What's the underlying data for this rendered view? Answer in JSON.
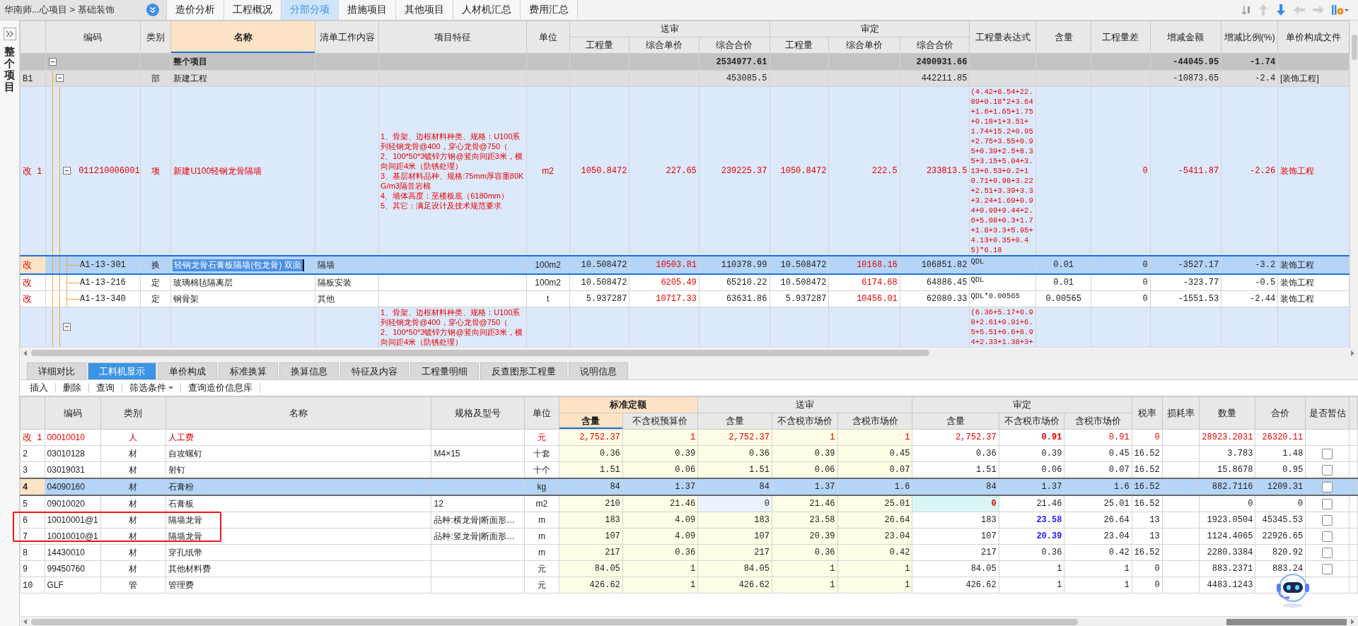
{
  "breadcrumb": "华南师...心项目 > 基础装饰",
  "tabs": [
    {
      "label": "造价分析",
      "selected": false
    },
    {
      "label": "工程概况",
      "selected": false
    },
    {
      "label": "分部分项",
      "selected": true
    },
    {
      "label": "措施项目",
      "selected": false
    },
    {
      "label": "其他项目",
      "selected": false
    },
    {
      "label": "人材机汇总",
      "selected": false
    },
    {
      "label": "费用汇总",
      "selected": false
    }
  ],
  "side_panel": {
    "title": "整个项目"
  },
  "upper_grid": {
    "header": [
      {
        "label": "编码",
        "selected": false
      },
      {
        "label": "类别",
        "selected": false
      },
      {
        "label": "名称",
        "selected": true
      },
      {
        "label": "清单工作内容",
        "selected": false
      },
      {
        "label": "项目特征",
        "selected": false
      },
      {
        "label": "单位",
        "selected": false
      },
      {
        "group": "送审",
        "columns": [
          {
            "label": "工程量",
            "selected": false
          },
          {
            "label": "综合单价",
            "selected": false
          },
          {
            "label": "综合合价",
            "selected": false
          }
        ]
      },
      {
        "group": "审定",
        "columns": [
          {
            "label": "工程量",
            "selected": false
          },
          {
            "label": "综合单价",
            "selected": false
          },
          {
            "label": "综合合价",
            "selected": false
          }
        ]
      },
      {
        "label": "工程量表达式",
        "selected": false
      },
      {
        "label": "含量",
        "selected": false
      },
      {
        "label": "工程量差",
        "selected": false
      },
      {
        "label": "增减金额",
        "selected": false
      },
      {
        "label": "增减比例(%)",
        "selected": false
      },
      {
        "label": "单价构成文件",
        "selected": false
      }
    ],
    "rows": [
      {
        "kind": "total",
        "expanded": true,
        "selected": false,
        "cells": [
          null,
          "整个项目",
          null,
          null,
          null,
          null,
          null,
          "2534977.61",
          null,
          null,
          "2490931.66",
          null,
          null,
          null,
          "-44045.95",
          "-1.74",
          null
        ],
        "children": [
          {
            "kind": "section",
            "number": "B1",
            "expanded": true,
            "selected": false,
            "cells": [
              "部",
              "新建工程",
              null,
              null,
              null,
              null,
              null,
              "453085.5",
              null,
              null,
              "442211.85",
              null,
              null,
              null,
              "-10873.65",
              "-2.4",
              "[装饰工程]"
            ],
            "children": [
              {
                "kind": "item",
                "flag": "改",
                "number": "1",
                "code": "011210006001",
                "expanded": true,
                "selected": false,
                "cells": [
                  "项",
                  "新建U100轻钢龙骨隔墙",
                  null,
                  "1、骨架、边框材料种类、规格：U100系列轻钢龙骨@400，穿心龙骨@750（\n2、100*50*3镀锌方钢@竖向间距3米，横向间距4米（防锈处理）\n3、基层材料品种、规格:75mm厚容重80KG/m3隔音岩棉\n4、墙体高度：至楼板底（6180mm）\n5、其它：满足设计及技术规范要求",
                  "m2",
                  "1050.8472",
                  "227.65",
                  "239225.37",
                  "1050.8472",
                  "222.5",
                  "233813.5",
                  "(4.42+8.54+22.89+0.18*2+3.64+1.6+1.65+1.75+0.18+1+3.51+1.74+15.2+0.95+2.75+3.55+0.95+0.39+2.5+8.35+3.15+5.04+3.13+6.53+0.2+10.71+0.98+3.22+2.51+3.39+3.3+3.24+1.69+0.94+0.99+9.44+2.6+5.08+0.3+1.7+1.8+3.3+5.95+4.13+0.35+0.45)*6.18",
                  null,
                  "0",
                  "-5411.87",
                  "-2.26",
                  "装饰工程"
                ],
                "children": [
                  {
                    "kind": "quota",
                    "flag": "改",
                    "code": "A1-13-301",
                    "selected": true,
                    "cells": [
                      "换",
                      {
                        "text": "轻钢龙骨石膏板隔墙(包龙骨) 双面",
                        "kind": "editing"
                      },
                      "隔墙",
                      null,
                      "100m2",
                      "10.508472",
                      {
                        "text": "10503.81",
                        "kind": "changed"
                      },
                      "110378.99",
                      "10.508472",
                      {
                        "text": "10168.16",
                        "kind": "changed"
                      },
                      "106851.82",
                      "QDL",
                      "0.01",
                      "0",
                      "-3527.17",
                      "-3.2",
                      "装饰工程"
                    ]
                  },
                  {
                    "kind": "quota",
                    "flag": "改",
                    "code": "A1-13-216",
                    "selected": false,
                    "cells": [
                      "定",
                      "玻璃棉毡隔离层",
                      "隔板安装",
                      null,
                      "100m2",
                      "10.508472",
                      {
                        "text": "6205.49",
                        "kind": "changed"
                      },
                      "65210.22",
                      "10.508472",
                      {
                        "text": "6174.68",
                        "kind": "changed"
                      },
                      "64886.45",
                      "QDL",
                      "0.01",
                      "0",
                      "-323.77",
                      "-0.5",
                      "装饰工程"
                    ]
                  },
                  {
                    "kind": "quota",
                    "flag": "改",
                    "code": "A1-13-340",
                    "selected": false,
                    "cells": [
                      "定",
                      "钢骨架",
                      "其他",
                      null,
                      "t",
                      "5.937287",
                      {
                        "text": "10717.33",
                        "kind": "changed"
                      },
                      "63631.86",
                      "5.937287",
                      {
                        "text": "10456.01",
                        "kind": "changed"
                      },
                      "62080.33",
                      "QDL*0.00565",
                      "0.00565",
                      "0",
                      "-1551.53",
                      "-2.44",
                      "装饰工程"
                    ]
                  }
                ]
              },
              {
                "kind": "item",
                "expanded": true,
                "selected": false,
                "cells": [
                  null,
                  null,
                  null,
                  "1、骨架、边框材料种类、规格：U100系列轻钢龙骨@400，穿心龙骨@750（\n2、100*50*3镀锌方钢@竖向间距3米，横向间距4米（防锈处理）",
                  null,
                  null,
                  null,
                  null,
                  null,
                  null,
                  null,
                  "(6.36+5.17+0.98+2.61+0.91+6.5+5.51+0.6+8.94+2.33+1.38+3+",
                  null,
                  null,
                  null,
                  null,
                  null
                ]
              }
            ]
          }
        ]
      }
    ]
  },
  "detail_tabs": [
    {
      "label": "详细对比",
      "selected": false
    },
    {
      "label": "工料机显示",
      "selected": true
    },
    {
      "label": "单价构成",
      "selected": false
    },
    {
      "label": "标准换算",
      "selected": false
    },
    {
      "label": "换算信息",
      "selected": false
    },
    {
      "label": "特征及内容",
      "selected": false
    },
    {
      "label": "工程量明细",
      "selected": false
    },
    {
      "label": "反查图形工程量",
      "selected": false
    },
    {
      "label": "说明信息",
      "selected": false
    }
  ],
  "toolbar": [
    {
      "label": "插入",
      "dropdown": false
    },
    {
      "label": "删除",
      "dropdown": false
    },
    {
      "label": "查询",
      "dropdown": false
    },
    {
      "label": "筛选条件",
      "dropdown": true
    },
    {
      "label": "查询造价信息库",
      "dropdown": false
    }
  ],
  "lower_grid": {
    "header": [
      {
        "label": "编码",
        "selected": false
      },
      {
        "label": "类别",
        "selected": false
      },
      {
        "label": "名称",
        "selected": false
      },
      {
        "label": "规格及型号",
        "selected": false
      },
      {
        "label": "单位",
        "selected": false
      },
      {
        "group": "标准定额",
        "columns": [
          {
            "label": "含量",
            "selected": true
          },
          {
            "label": "不含税预算价",
            "selected": false
          }
        ]
      },
      {
        "group": "送审",
        "columns": [
          {
            "label": "含量",
            "selected": false
          },
          {
            "label": "不含税市场价",
            "selected": false
          },
          {
            "label": "含税市场价",
            "selected": false
          }
        ]
      },
      {
        "group": "审定",
        "columns": [
          {
            "label": "含量",
            "selected": false
          },
          {
            "label": "不含税市场价",
            "selected": false
          },
          {
            "label": "含税市场价",
            "selected": false
          }
        ]
      },
      {
        "label": "税率",
        "selected": false
      },
      {
        "label": "损耗率",
        "selected": false
      },
      {
        "label": "数量",
        "selected": false
      },
      {
        "label": "合价",
        "selected": false
      },
      {
        "label": "是否暂估",
        "selected": false
      }
    ],
    "rows": [
      {
        "flag": "改",
        "number": "1",
        "modified": true,
        "selected": false,
        "cells": [
          "00010010",
          "人",
          "人工费",
          null,
          "元",
          "2,752.37",
          "1",
          "2,752.37",
          "1",
          "1",
          "2,752.37",
          {
            "text": "0.91",
            "kind": "adjusted"
          },
          "0.91",
          "0",
          null,
          "28923.2031",
          "26320.11"
        ]
      },
      {
        "number": "2",
        "modified": false,
        "selected": false,
        "provisional": false,
        "cells": [
          "03010128",
          "材",
          "自攻螺钉",
          "M4×15",
          "十套",
          "0.36",
          "0.39",
          "0.36",
          "0.39",
          "0.45",
          "0.36",
          "0.39",
          "0.45",
          "16.52",
          null,
          "3.783",
          "1.48"
        ]
      },
      {
        "number": "3",
        "modified": false,
        "selected": false,
        "provisional": false,
        "cells": [
          "03019031",
          "材",
          "射钉",
          null,
          "十个",
          "1.51",
          "0.06",
          "1.51",
          "0.06",
          "0.07",
          "1.51",
          "0.06",
          "0.07",
          "16.52",
          null,
          "15.8678",
          "0.95"
        ]
      },
      {
        "number": "4",
        "modified": false,
        "selected": true,
        "provisional": false,
        "cells": [
          "04090160",
          "材",
          "石膏粉",
          null,
          "kg",
          "84",
          "1.37",
          "84",
          "1.37",
          "1.6",
          "84",
          "1.37",
          "1.6",
          "16.52",
          null,
          "882.7116",
          "1209.31"
        ]
      },
      {
        "number": "5",
        "modified": false,
        "selected": false,
        "provisional": false,
        "cells": [
          "09010020",
          "材",
          "石膏板",
          "12",
          "m2",
          "210",
          "21.46",
          {
            "text": "0",
            "kind": "pale"
          },
          "21.46",
          "25.01",
          {
            "text": "0",
            "kind": "zeroed"
          },
          "21.46",
          "25.01",
          "16.52",
          null,
          "0",
          "0"
        ]
      },
      {
        "number": "6",
        "modified": false,
        "selected": false,
        "provisional": false,
        "cells": [
          "10010001@1",
          "材",
          "隔墙龙骨",
          "品种:横龙骨|断面形…",
          "m",
          "183",
          "4.09",
          "183",
          "23.58",
          "26.64",
          "183",
          {
            "text": "23.58",
            "kind": "raised"
          },
          "26.64",
          "13",
          null,
          "1923.0504",
          "45345.53"
        ]
      },
      {
        "number": "7",
        "modified": false,
        "selected": false,
        "provisional": false,
        "cells": [
          "10010010@1",
          "材",
          "隔墙龙骨",
          "品种:竖龙骨|断面形…",
          "m",
          "107",
          "4.09",
          "107",
          "20.39",
          "23.04",
          "107",
          {
            "text": "20.39",
            "kind": "raised"
          },
          "23.04",
          "13",
          null,
          "1124.4065",
          "22926.65"
        ]
      },
      {
        "number": "8",
        "modified": false,
        "selected": false,
        "provisional": false,
        "cells": [
          "14430010",
          "材",
          "穿孔纸带",
          null,
          "m",
          "217",
          "0.36",
          "217",
          "0.36",
          "0.42",
          "217",
          "0.36",
          "0.42",
          "16.52",
          null,
          "2280.3384",
          "820.92"
        ]
      },
      {
        "number": "9",
        "modified": false,
        "selected": false,
        "provisional": false,
        "cells": [
          "99450760",
          "材",
          "其他材料费",
          null,
          "元",
          "84.05",
          "1",
          "84.05",
          "1",
          "1",
          "84.05",
          "1",
          "1",
          "0",
          null,
          "883.2371",
          "883.24"
        ]
      },
      {
        "number": "10",
        "modified": false,
        "selected": false,
        "cells": [
          "GLF",
          "管",
          "管理费",
          null,
          "元",
          "426.62",
          "1",
          "426.62",
          "1",
          "1",
          "426.62",
          "1",
          "1",
          "0",
          null,
          "4483.1243",
          null
        ]
      }
    ]
  }
}
